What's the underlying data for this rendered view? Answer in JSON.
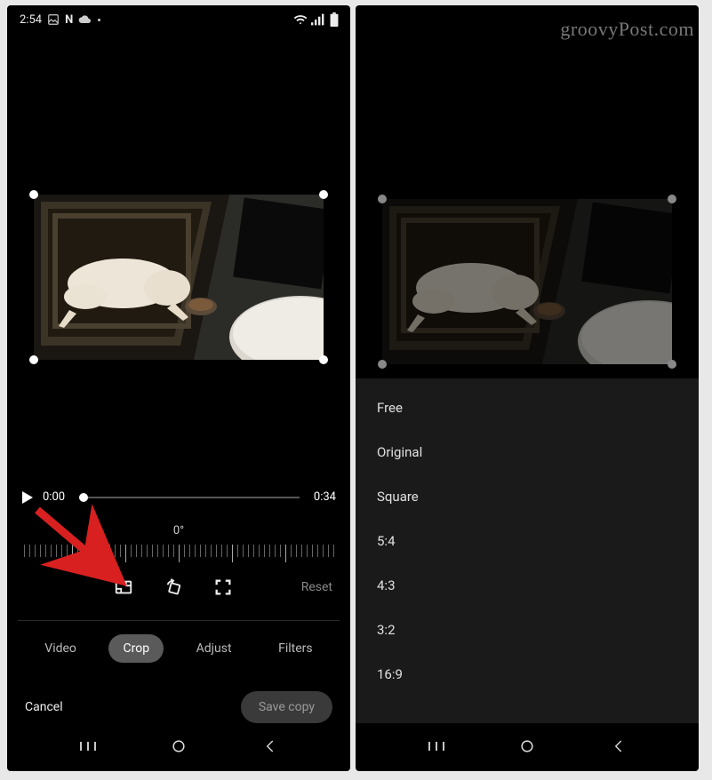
{
  "watermark": "groovyPost.com",
  "status": {
    "time": "2:54",
    "icons": [
      "image-icon",
      "netflix-icon",
      "cloud-icon",
      "dot-icon"
    ],
    "right_icons": [
      "wifi-icon",
      "signal-icon",
      "battery-icon"
    ]
  },
  "player": {
    "current_time": "0:00",
    "duration": "0:34"
  },
  "dial": {
    "angle": "0°"
  },
  "tools": {
    "reset": "Reset",
    "icons": [
      "aspect-ratio-icon",
      "rotate-icon",
      "fullscreen-icon"
    ]
  },
  "tabs": [
    {
      "label": "Video",
      "active": false
    },
    {
      "label": "Crop",
      "active": true
    },
    {
      "label": "Adjust",
      "active": false
    },
    {
      "label": "Filters",
      "active": false
    }
  ],
  "actions": {
    "cancel": "Cancel",
    "save": "Save copy"
  },
  "aspect_ratios": [
    "Free",
    "Original",
    "Square",
    "5:4",
    "4:3",
    "3:2",
    "16:9"
  ]
}
